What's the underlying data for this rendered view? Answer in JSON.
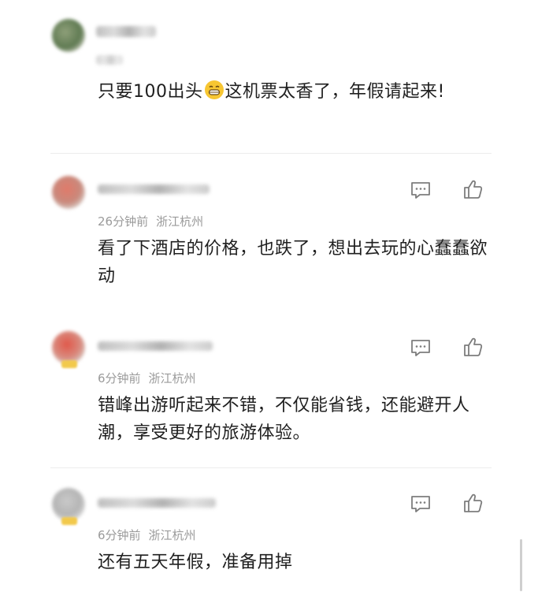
{
  "comments": [
    {
      "text_before_emoji": "只要100出头",
      "emoji": "grinning-face-emoji",
      "text_after_emoji": "这机票太香了，年假请起来!",
      "time": "",
      "location": ""
    },
    {
      "text": "看了下酒店的价格，也跌了，想出去玩的心蠢蠢欲动",
      "time": "26分钟前",
      "location": "浙江杭州"
    },
    {
      "text": "错峰出游听起来不错，不仅能省钱，还能避开人潮，享受更好的旅游体验。",
      "time": "6分钟前",
      "location": "浙江杭州"
    },
    {
      "text": "还有五天年假，准备用掉",
      "time": "6分钟前",
      "location": "浙江杭州"
    }
  ],
  "icons": {
    "reply": "comment-bubble-icon",
    "like": "thumbs-up-icon"
  },
  "colors": {
    "text": "#1f1f1f",
    "meta": "#9a9a9a",
    "icon": "#7d7d7d",
    "badge": "#f2c94c"
  }
}
